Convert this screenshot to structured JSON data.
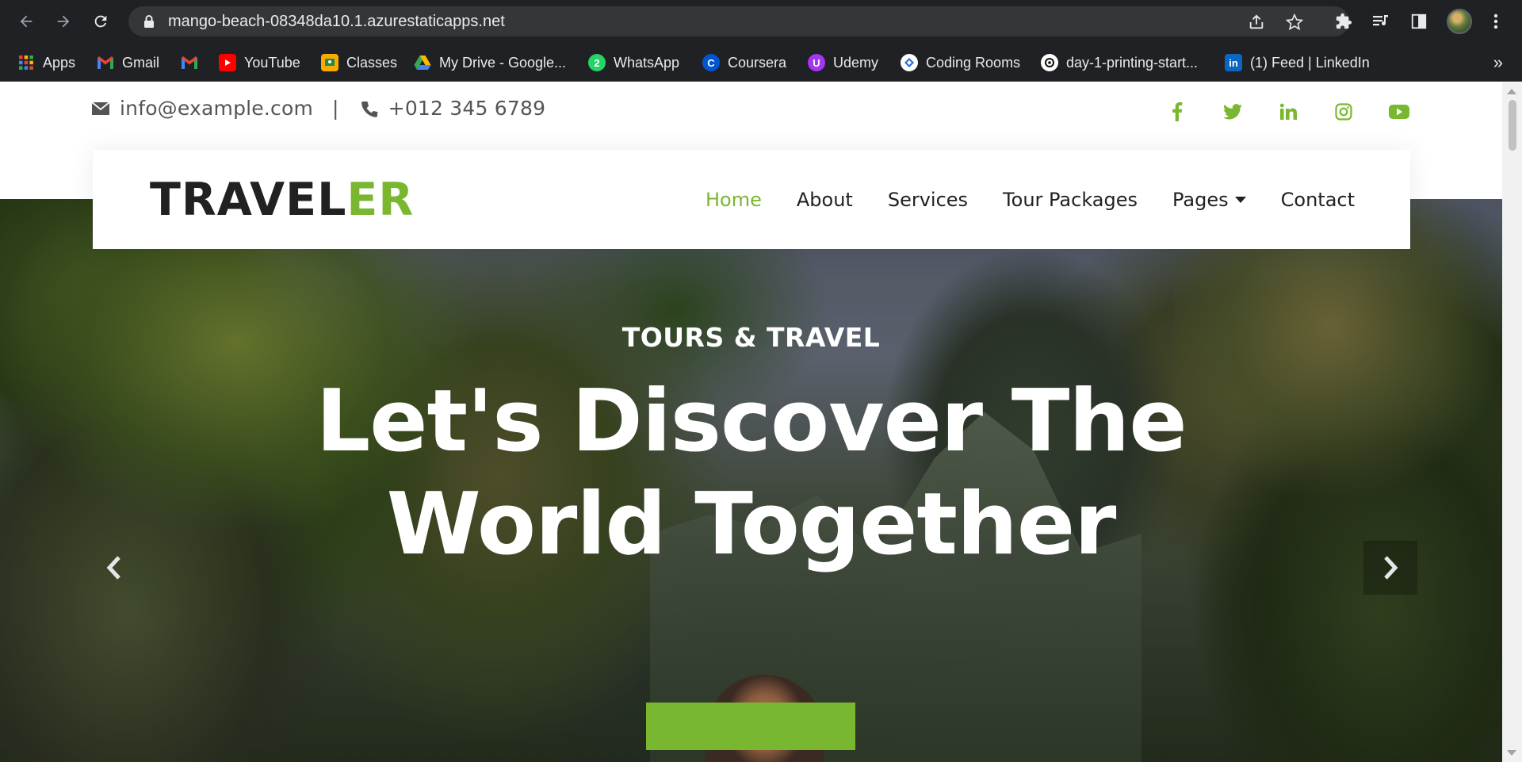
{
  "browser": {
    "url": "mango-beach-08348da10.1.azurestaticapps.net",
    "bookmarks": [
      {
        "label": "Apps",
        "icon": "apps-grid-icon",
        "color": "#4285f4"
      },
      {
        "label": "Gmail",
        "icon": "gmail-icon",
        "color": "#ea4335"
      },
      {
        "label": "",
        "icon": "gmail-icon",
        "color": "#ea4335"
      },
      {
        "label": "YouTube",
        "icon": "youtube-icon",
        "color": "#ff0000"
      },
      {
        "label": "Classes",
        "icon": "classroom-icon",
        "color": "#f9ab00"
      },
      {
        "label": "My Drive - Google...",
        "icon": "drive-icon",
        "color": "#34a853"
      },
      {
        "label": "WhatsApp",
        "icon": "whatsapp-icon",
        "color": "#25d366"
      },
      {
        "label": "Coursera",
        "icon": "coursera-icon",
        "color": "#0056d2"
      },
      {
        "label": "Udemy",
        "icon": "udemy-icon",
        "color": "#a435f0"
      },
      {
        "label": "Coding Rooms",
        "icon": "coding-rooms-icon",
        "color": "#ffffff"
      },
      {
        "label": "day-1-printing-start...",
        "icon": "replit-icon",
        "color": "#ffffff"
      },
      {
        "label": "(1) Feed | LinkedIn",
        "icon": "linkedin-icon",
        "color": "#0a66c2"
      }
    ],
    "more": "»"
  },
  "topbar": {
    "email": "info@example.com",
    "separator": "|",
    "phone": "+012 345 6789",
    "socials": [
      "facebook-icon",
      "twitter-icon",
      "linkedin-icon",
      "instagram-icon",
      "youtube-icon"
    ]
  },
  "navbar": {
    "brand_part1": "TRAVEL",
    "brand_part2": "ER",
    "links": {
      "home": "Home",
      "about": "About",
      "services": "Services",
      "tour_packages": "Tour Packages",
      "pages": "Pages",
      "contact": "Contact"
    }
  },
  "hero": {
    "subtitle": "TOURS & TRAVEL",
    "title_line1": "Let's Discover The",
    "title_line2": "World Together"
  },
  "colors": {
    "accent": "#7ab730",
    "dark_text": "#212121",
    "chrome_bg": "#202124"
  }
}
